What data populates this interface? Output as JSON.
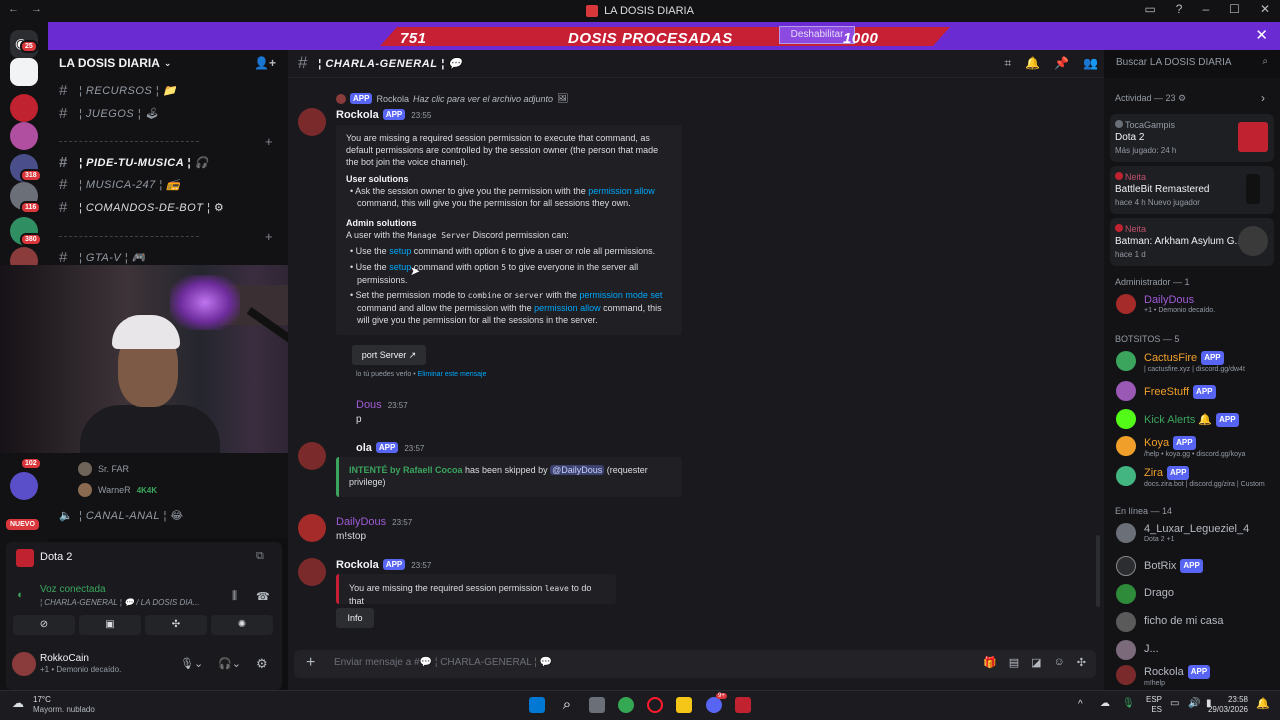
{
  "window": {
    "title": "LA DOSIS DIARIA"
  },
  "banner": {
    "count_left": "751",
    "label": "DOSIS PROCESADAS",
    "disable_label": "Deshabilitar",
    "count_right": "1000"
  },
  "rail": {
    "badges": [
      "25",
      "318",
      "116",
      "380",
      "102",
      "NUEVO"
    ]
  },
  "server": {
    "name": "LA DOSIS DIARIA"
  },
  "channels": [
    {
      "emoji": "📁",
      "name": "¦ RECURSOS ¦ 📁"
    },
    {
      "emoji": "🎮",
      "name": "¦ JUEGOS ¦ 🕹"
    },
    {
      "emoji": "💫",
      "name": "¦ PIDE-TU-MUSICA ¦ 🎧"
    },
    {
      "emoji": "🎵",
      "name": "¦ MUSICA-247 ¦ 📻"
    },
    {
      "emoji": "🤖",
      "name": "¦ COMANDOS-DE-BOT ¦ ⚙"
    },
    {
      "emoji": "🎮",
      "name": "¦ GTA-V ¦ 🎮"
    }
  ],
  "voice_users": [
    {
      "name": "Sr. FAR"
    },
    {
      "name": "WarneR",
      "badge": "4K4K"
    }
  ],
  "voice_channel": {
    "name": "¦ CANAL-ANAL ¦ 😂"
  },
  "activity_panel": {
    "game": "Dota 2",
    "voice_status": "Voz conectada",
    "voice_location": "¦ CHARLA-GENERAL ¦ 💬 / LA DOSIS DIA..."
  },
  "user": {
    "name": "RokkoCain",
    "status": "+1 • Demonio decaído."
  },
  "chat": {
    "channel_name": "¦ CHARLA-GENERAL ¦ 💬",
    "reply_ref": {
      "app": "APP",
      "user": "Rockola",
      "text": "Haz clic para ver el archivo adjunto"
    },
    "messages": [
      {
        "author": "Rockola",
        "tag": "APP",
        "time": "23:55",
        "embed": {
          "intro": "You are missing a required session permission to execute that command, as default permissions are controlled by the session owner (the person that made the bot join the voice channel).",
          "user_title": "User solutions",
          "user_1a": "Ask the session owner to give you the permission with the ",
          "user_1b": "permission allow",
          "user_1c": " command, this will give you the permission for all sessions they own.",
          "admin_title": "Admin solutions",
          "admin_intro_a": "A user with the ",
          "admin_intro_code": "Manage Server",
          "admin_intro_b": " Discord permission can:",
          "a1a": "Use the ",
          "a1b": "setup",
          "a1c": " command with option ",
          "a1d": "6",
          "a1e": " to give a user or role all permissions.",
          "a2a": "Use the ",
          "a2b": "setup",
          "a2c": " command with option ",
          "a2d": "5",
          "a2e": " to give everyone in the server all permissions.",
          "a3a": "Set the permission mode to ",
          "a3b": "combine",
          "a3c": " or ",
          "a3d": "server",
          "a3e": " with the ",
          "a3f": "permission mode set",
          "a3g": " command and allow the permission with the ",
          "a3h": "permission allow",
          "a3i": " command, this will give you the permission for all the sessions in the server."
        },
        "button": "port Server",
        "ephemeral": "lo tú puedes verlo • ",
        "ephemeral_link": "Eliminar este mensaje"
      },
      {
        "author": "Dous",
        "time": "23:57",
        "text": "p"
      },
      {
        "author": "ola",
        "tag": "APP",
        "time": "23:57",
        "embed_a": "INTENTÉ by Rafaell Cocoa",
        "embed_b": " has been skipped by ",
        "embed_c": "@DailyDous",
        "embed_d": " (requester privilege)"
      },
      {
        "author": "DailyDous",
        "time": "23:57",
        "text": "m!stop"
      },
      {
        "author": "Rockola",
        "tag": "APP",
        "time": "23:57",
        "embed_a": "You are missing the required session permission ",
        "embed_code": "leave",
        "embed_b": " to do that",
        "button": "Info"
      }
    ],
    "composer_placeholder": "Enviar mensaje a #💬 ¦ CHARLA-GENERAL ¦ 💬"
  },
  "search": {
    "placeholder": "Buscar LA DOSIS DIARIA"
  },
  "members": {
    "activity_header": "Actividad — 23",
    "activities": [
      {
        "who": "TocaGampis",
        "game": "Dota 2",
        "sub": "Más jugado: 24 h",
        "art_color": "#c0232f"
      },
      {
        "who": "Neita",
        "game": "BattleBit Remastered",
        "sub": "hace 4 h   Nuevo jugador",
        "art_color": "#111111"
      },
      {
        "who": "Neita",
        "game": "Batman: Arkham Asylum G...",
        "sub": "hace 1 d",
        "art_color": "#3a3a3a"
      }
    ],
    "admin_header": "Administrador — 1",
    "admin": {
      "name": "DailyDous",
      "status": "+1 • Demonio decaído."
    },
    "bots_header": "BOTSITOS — 5",
    "bots": [
      {
        "name": "CactusFire",
        "tag": "APP",
        "status": "| cactusfire.xyz | discord.gg/dw4t",
        "color": "#3ba55d"
      },
      {
        "name": "FreeStuff",
        "tag": "APP",
        "status": "",
        "color": "#9b59b6"
      },
      {
        "name": "Kick Alerts",
        "tag": "APP",
        "status": "",
        "color": "#53fc18"
      },
      {
        "name": "Koya",
        "tag": "APP",
        "status": "/help • koya.gg • discord.gg/koya",
        "color": "#f0a02a"
      },
      {
        "name": "Zira",
        "tag": "APP",
        "status": "docs.zira.bot | discord.gg/zira | Custom",
        "color": "#43b581"
      }
    ],
    "online_header": "En línea — 14",
    "online": [
      {
        "name": "4_Luxar_Legueziel_4",
        "status": "Dota 2 +1"
      },
      {
        "name": "BotRix",
        "tag": "APP",
        "status": ""
      },
      {
        "name": "Drago",
        "status": ""
      },
      {
        "name": "ficho de mi casa",
        "status": ""
      },
      {
        "name": "J...",
        "status": ""
      },
      {
        "name": "Rockola",
        "tag": "APP",
        "status": "m!help"
      }
    ]
  },
  "taskbar": {
    "weather_temp": "17°C",
    "weather_desc": "Mayorm. nublado",
    "lang": "ESP",
    "lang2": "ES",
    "time": "23:58",
    "date": "29/03/2026",
    "discord_badge": "9+"
  }
}
